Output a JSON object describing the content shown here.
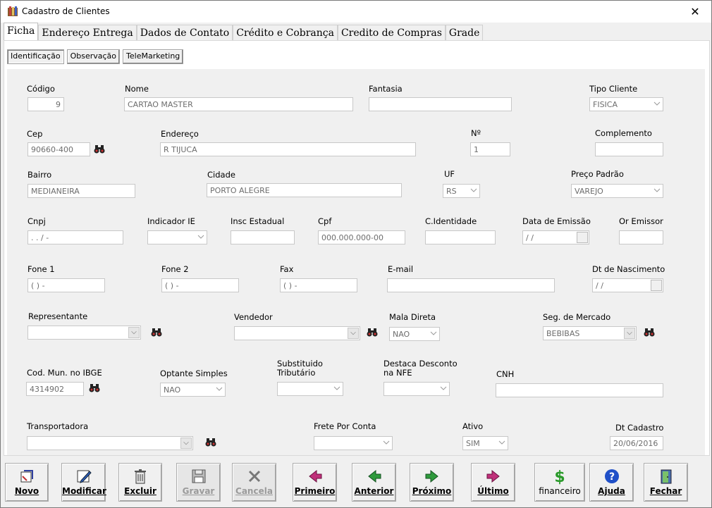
{
  "window": {
    "title": "Cadastro de Clientes",
    "close_glyph": "✕",
    "app_icon": "books-icon"
  },
  "tabs": [
    "Ficha",
    "Endereço Entrega",
    "Dados de Contato",
    "Crédito e Cobrança",
    "Credito de Compras",
    "Grade"
  ],
  "subtabs": [
    "Identificação",
    "Observação",
    "TeleMarketing"
  ],
  "form": {
    "codigo": {
      "label": "Código",
      "value": "9"
    },
    "nome": {
      "label": "Nome",
      "value": "CARTAO MASTER"
    },
    "fantasia": {
      "label": "Fantasia",
      "value": ""
    },
    "tipo_cliente": {
      "label": "Tipo Cliente",
      "value": "FISICA"
    },
    "cep": {
      "label": "Cep",
      "value": "90660-400"
    },
    "endereco": {
      "label": "Endereço",
      "value": "R TIJUCA"
    },
    "numero": {
      "label": "Nº",
      "value": "1"
    },
    "complemento": {
      "label": "Complemento",
      "value": ""
    },
    "bairro": {
      "label": "Bairro",
      "value": "MEDIANEIRA"
    },
    "cidade": {
      "label": "Cidade",
      "value": "PORTO ALEGRE"
    },
    "uf": {
      "label": "UF",
      "value": "RS"
    },
    "preco_padrao": {
      "label": "Preço Padrão",
      "value": "VAREJO"
    },
    "cnpj": {
      "label": "Cnpj",
      "value": " .  .  /    -"
    },
    "indicador_ie": {
      "label": "Indicador IE",
      "value": ""
    },
    "insc_estadual": {
      "label": "Insc Estadual",
      "value": ""
    },
    "cpf": {
      "label": "Cpf",
      "value": "000.000.000-00"
    },
    "c_identidade": {
      "label": "C.Identidade",
      "value": ""
    },
    "data_emissao": {
      "label": "Data de Emissão",
      "value": " /  /"
    },
    "or_emissor": {
      "label": "Or Emissor",
      "value": ""
    },
    "fone1": {
      "label": "Fone 1",
      "value": "( )    -"
    },
    "fone2": {
      "label": "Fone 2",
      "value": "( )    -"
    },
    "fax": {
      "label": "Fax",
      "value": "( )    -"
    },
    "email": {
      "label": "E-mail",
      "value": ""
    },
    "dt_nascimento": {
      "label": "Dt de Nascimento",
      "value": " /  /"
    },
    "representante": {
      "label": "Representante",
      "value": ""
    },
    "vendedor": {
      "label": "Vendedor",
      "value": ""
    },
    "mala_direta": {
      "label": "Mala Direta",
      "value": "NAO"
    },
    "seg_mercado": {
      "label": "Seg. de Mercado",
      "value": "BEBIBAS"
    },
    "cod_mun_ibge": {
      "label": "Cod. Mun. no IBGE",
      "value": "4314902"
    },
    "optante_simples": {
      "label": "Optante Simples",
      "value": "NAO"
    },
    "substituido_l1": "Substituido",
    "substituido_l2": "Tributário",
    "substituido_value": "",
    "destaca_l1": "Destaca Desconto",
    "destaca_l2": "na NFE",
    "destaca_value": "",
    "cnh": {
      "label": "CNH",
      "value": ""
    },
    "transportadora": {
      "label": "Transportadora",
      "value": ""
    },
    "frete_por_conta": {
      "label": "Frete Por Conta",
      "value": ""
    },
    "ativo": {
      "label": "Ativo",
      "value": "SIM"
    },
    "dt_cadastro": {
      "label": "Dt Cadastro",
      "value": "20/06/2016"
    }
  },
  "buttons": {
    "novo": {
      "label": "Novo",
      "icon": "new-record-icon",
      "enabled": true
    },
    "modificar": {
      "label": "Modificar",
      "icon": "edit-pencil-icon",
      "enabled": true
    },
    "excluir": {
      "label": "Excluir",
      "icon": "trash-icon",
      "enabled": true
    },
    "gravar": {
      "label": "Gravar",
      "icon": "floppy-disk-icon",
      "enabled": false
    },
    "cancela": {
      "label": "Cancela",
      "icon": "cancel-x-icon",
      "enabled": false
    },
    "primeiro": {
      "label": "Primeiro",
      "icon": "first-arrow-icon",
      "enabled": true
    },
    "anterior": {
      "label": "Anterior",
      "icon": "previous-arrow-icon",
      "enabled": true
    },
    "proximo": {
      "label": "Próximo",
      "icon": "next-arrow-icon",
      "enabled": true
    },
    "ultimo": {
      "label": "Último",
      "icon": "last-arrow-icon",
      "enabled": true
    },
    "financeiro": {
      "label": "financeiro",
      "icon": "dollar-icon",
      "enabled": true
    },
    "ajuda": {
      "label": "Ajuda",
      "icon": "help-icon",
      "enabled": true
    },
    "fechar": {
      "label": "Fechar",
      "icon": "exit-door-icon",
      "enabled": true
    }
  },
  "colors": {
    "window_bg": "#f0f0f0",
    "field_border": "#c8c8c8",
    "arrow_magenta": "#c0307a",
    "arrow_green": "#2e9a3c",
    "dollar_green": "#2a9a2a",
    "help_blue": "#2050c8"
  }
}
